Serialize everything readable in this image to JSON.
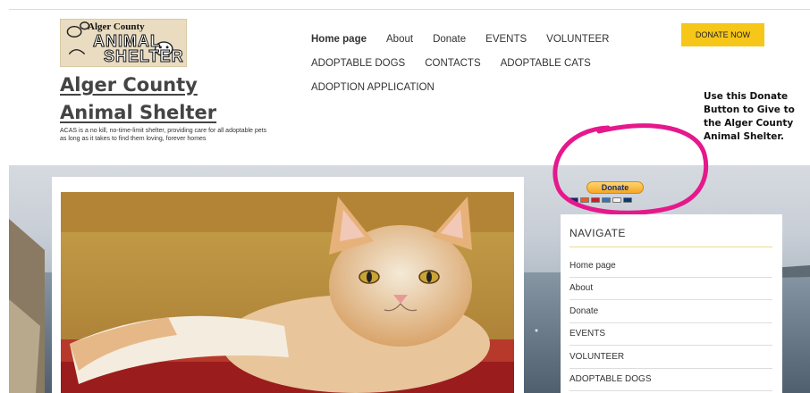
{
  "header": {
    "logo": {
      "line1": "Alger County",
      "line2": "ANIMAL",
      "line3": "SHELTER"
    },
    "site_title": "Alger County Animal Shelter",
    "tagline": "ACAS is a no kill, no-time-limit shelter, providing care for all adoptable pets as long as it takes to find them loving, forever homes"
  },
  "nav": {
    "rows": [
      [
        "Home page",
        "About",
        "Donate",
        "EVENTS",
        "VOLUNTEER"
      ],
      [
        "ADOPTABLE DOGS",
        "CONTACTS",
        "ADOPTABLE CATS"
      ],
      [
        "ADOPTION APPLICATION"
      ]
    ],
    "active": "Home page"
  },
  "donate_now": "DONATE NOW",
  "callout": "Use this Donate Button to Give to the Alger County Animal Shelter.",
  "paypal": {
    "button": "Donate"
  },
  "sidebar": {
    "title": "NAVIGATE",
    "items": [
      "Home page",
      "About",
      "Donate",
      "EVENTS",
      "VOLUNTEER",
      "ADOPTABLE DOGS"
    ]
  },
  "colors": {
    "accent": "#f6c719",
    "circle": "#e5188c",
    "paypal_blue": "#16306b"
  }
}
